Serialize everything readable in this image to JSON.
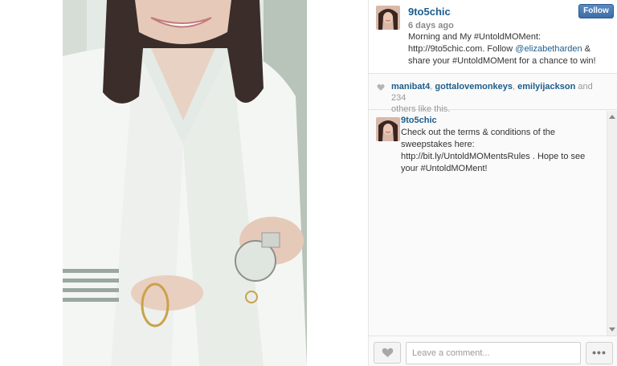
{
  "post": {
    "username": "9to5chic",
    "time_ago": "6 days ago",
    "follow_label": "Follow",
    "caption_part1": "Morning and My #UntoldMOMent:",
    "caption_part2": "http://9to5chic.com. Follow ",
    "caption_mention": "@elizabetharden",
    "caption_part3": " & share your #UntoldMOMent for a chance to win!"
  },
  "likes": {
    "likers": [
      "manibat4",
      "gottalovemonkeys",
      "emilyijackson"
    ],
    "separator": ", ",
    "suffix_and": " and ",
    "count": "234",
    "suffix_text": "others like this."
  },
  "comments": [
    {
      "username": "9to5chic",
      "text": "Check out the terms & conditions of the sweepstakes here: http://bit.ly/UntoldMOMentsRules . Hope to see your #UntoldMOMent!"
    }
  ],
  "footer": {
    "comment_placeholder": "Leave a comment...",
    "more_label": "•••"
  },
  "icons": {
    "heart": "heart-icon",
    "ellipsis": "ellipsis-icon"
  },
  "colors": {
    "link": "#1d5d8c",
    "follow_button": "#3b6ea8",
    "muted": "#999999"
  }
}
